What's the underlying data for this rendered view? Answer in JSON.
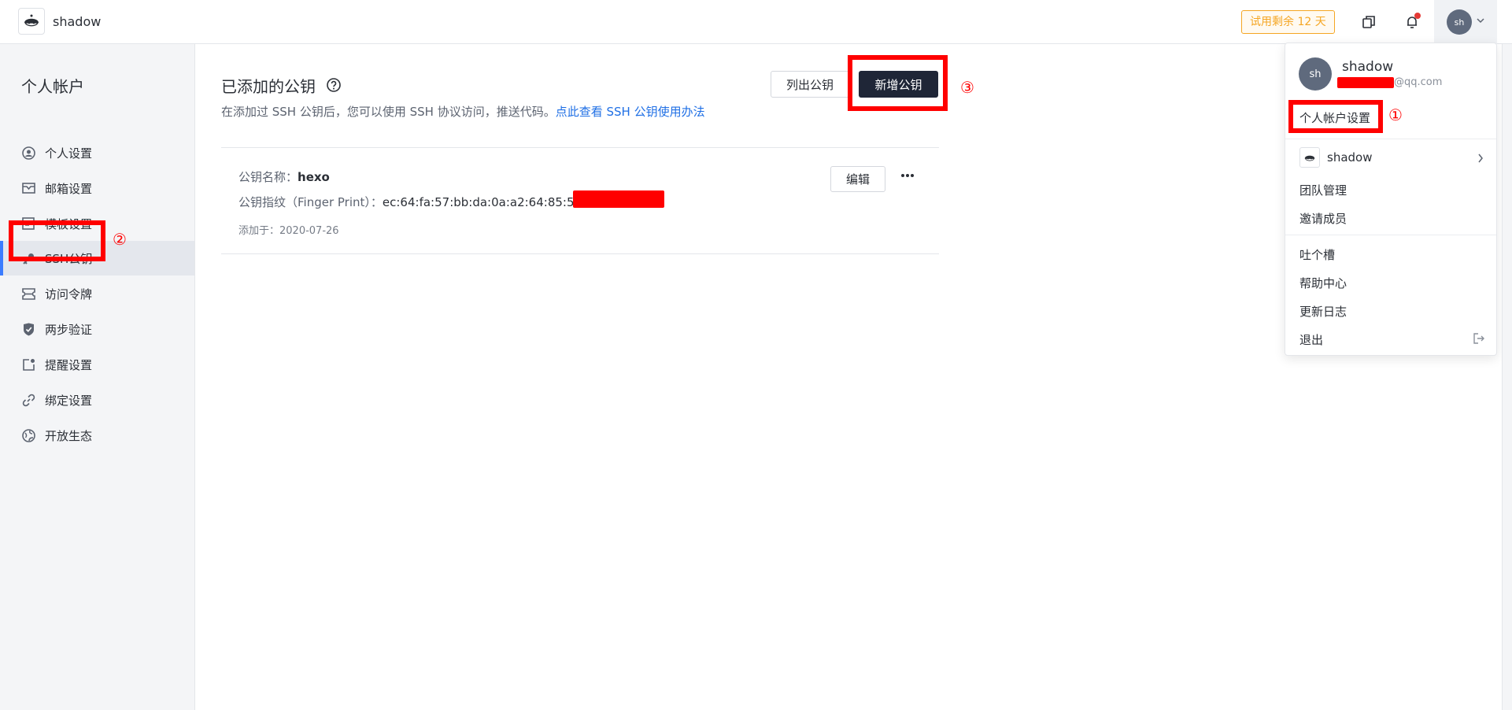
{
  "header": {
    "brand": "shadow",
    "trial": "试用剩余 12 天",
    "avatar_initials": "sh",
    "icons": [
      "copy-icon",
      "bell-icon"
    ]
  },
  "sidebar": {
    "title": "个人帐户",
    "items": [
      {
        "label": "个人设置",
        "icon": "user-circle-icon"
      },
      {
        "label": "邮箱设置",
        "icon": "mail-icon"
      },
      {
        "label": "模板设置",
        "icon": "template-icon"
      },
      {
        "label": "SSH公钥",
        "icon": "key-icon",
        "active": true
      },
      {
        "label": "访问令牌",
        "icon": "ticket-icon"
      },
      {
        "label": "两步验证",
        "icon": "shield-check-icon"
      },
      {
        "label": "提醒设置",
        "icon": "reminder-icon"
      },
      {
        "label": "绑定设置",
        "icon": "link-icon"
      },
      {
        "label": "开放生态",
        "icon": "globe-icon"
      }
    ]
  },
  "main": {
    "title": "已添加的公钥",
    "description": "在添加过 SSH 公钥后，您可以使用 SSH 协议访问，推送代码。",
    "description_link": "点此查看 SSH 公钥使用办法",
    "list_button": "列出公钥",
    "new_button": "新增公钥",
    "key": {
      "name_label": "公钥名称：",
      "name": "hexo",
      "fingerprint_label": "公钥指纹（Finger Print）：",
      "fingerprint": "ec:64:fa:57:bb:da:0a:a2:64:85:52",
      "date": "添加于：2020-07-26",
      "edit_button": "编辑"
    }
  },
  "dropdown": {
    "avatar_initials": "sh",
    "username": "shadow",
    "email_suffix": "@qq.com",
    "account_settings": "个人帐户设置",
    "team_name": "shadow",
    "team_manage": "团队管理",
    "invite": "邀请成员",
    "feedback": "吐个槽",
    "help": "帮助中心",
    "changelog": "更新日志",
    "logout": "退出"
  },
  "annotations": [
    "①",
    "②",
    "③"
  ],
  "colors": {
    "accent": "#3b7cff",
    "primary_button": "#1f2637",
    "link": "#1f6fe5",
    "trial": "#f5a623",
    "annotation": "#ff0000"
  }
}
